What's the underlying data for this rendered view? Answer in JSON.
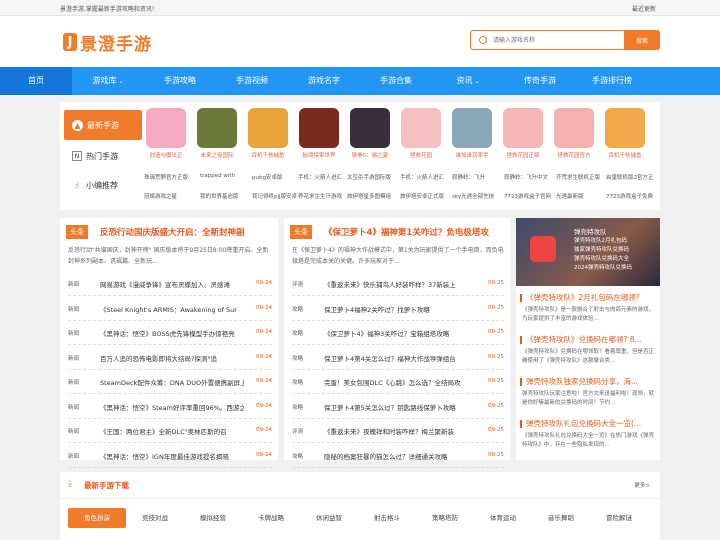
{
  "topbar": {
    "left": "景澄手游,掌握最新手游攻略和资讯!",
    "right": "最近更新"
  },
  "logo": {
    "mark": "J",
    "text": "景澄手游"
  },
  "search": {
    "placeholder": "请输入游戏名称",
    "button": "搜索"
  },
  "nav": [
    "首页",
    "游戏库",
    "手游攻略",
    "手游视频",
    "游戏名字",
    "手游合集",
    "资讯",
    "传奇手游",
    "手游排行榜"
  ],
  "side": [
    "最新手游",
    "热门手游",
    "小编推荐"
  ],
  "games": [
    {
      "name": "创造与魔法正",
      "color": "#f6a9c0"
    },
    {
      "name": "未来之役国际",
      "color": "#6b7a3a"
    },
    {
      "name": "百机千核捕鱼",
      "color": "#e8a43b"
    },
    {
      "name": "秘境探索世界",
      "color": "#7a2a1e"
    },
    {
      "name": "铁拳5：格之夏",
      "color": "#3b2e3a"
    },
    {
      "name": "拯救花园",
      "color": "#f7c0c0"
    },
    {
      "name": "谁加谁润率手",
      "color": "#8aa7b7"
    },
    {
      "name": "拯救花园正版",
      "color": "#f6b6b6"
    },
    {
      "name": "拯救花园官方",
      "color": "#f5b0b0"
    },
    {
      "name": "百机千核捕鱼",
      "color": "#f2a84a"
    }
  ],
  "row1": [
    "珠璃荒野官方正版",
    "trapped with",
    "pubg安卓版",
    "手机：火箭人进汇",
    "太空杀手游国际版",
    "手机：火箭人进汇",
    "寂静岭：飞升",
    "寂静岭：飞升中文",
    "齐荒求生联机正版",
    "启皇联机版2官方正"
  ],
  "row2": [
    "冠姬游戏之星",
    "我的世界基岩版",
    "我记得终pjj版安卓",
    "养花求生生汗游戏",
    "旅伊塔星多图模组",
    "旅伊塔安卓正式版",
    "sky光遇全部先技",
    "7723游戏盒子官网",
    "光遇最新版",
    "7723游戏盒子免费"
  ],
  "col1": {
    "badge": "头条",
    "title": "反恐行动国庆版盛大开启：全新封神副",
    "desc": "反恐行动\"共谱国庆，封神开榜\" 国庆版本将于9月25日8:00降重开启。全新封神系列副本、诱福篇、全新玩...",
    "items": [
      {
        "tag": "新闻",
        "title": "网易游戏《漫威争锋》宣布灵蝶加入、灵感滩",
        "date": "09-24"
      },
      {
        "tag": "新闻",
        "title": "《Steel Knight's ARMIS：Awakening of Sur",
        "date": "09-24"
      },
      {
        "tag": "新闻",
        "title": "《黑神话：悟空》BOSS虎先锋模型手办惊艳亮",
        "date": "09-24"
      },
      {
        "tag": "新闻",
        "title": "百万人追的恐怖电影即将大结局?探测\"追",
        "date": "09-24"
      },
      {
        "tag": "新闻",
        "title": "SteamDeck配件众筹：DNA DUO外置便携副屏上",
        "date": "09-24"
      },
      {
        "tag": "新闻",
        "title": "《黑神话：悟空》Steam好评率重回96%。西游之",
        "date": "09-24"
      },
      {
        "tag": "新闻",
        "title": "《王国：两位君主》全新DLC\"奥林匹斯的召",
        "date": "09-24"
      },
      {
        "tag": "新闻",
        "title": "《黑神话：悟空》IGN年度最佳游戏提名揭晓",
        "date": "09-24"
      }
    ]
  },
  "col2": {
    "badge": "头条",
    "title": "《保卫萝卜4》福神第1关咋过？负电极塔攻",
    "desc": "在《保卫萝卜4》的福神大作战模式中，第1关为玩家提供了一个手电筒，而负电极塔是完成本关的关键。许多玩家对于...",
    "items": [
      {
        "tag": "评测",
        "title": "《重返未来》快乐捕鸟人好装咋样？37新装上",
        "date": "09-25"
      },
      {
        "tag": "攻略",
        "title": "保卫萝卜4福神2关咋过？找萝卜攻略",
        "date": "09-25"
      },
      {
        "tag": "攻略",
        "title": "《保卫萝卜4》福神3关咋过？宝箱组塔攻略",
        "date": "09-25"
      },
      {
        "tag": "攻略",
        "title": "保卫萝卜4第4关怎么过？福神大作战导弹组台",
        "date": "09-25"
      },
      {
        "tag": "攻略",
        "title": "完蛋！美女包围DLC《心跳》怎么选？全结局攻",
        "date": "09-25"
      },
      {
        "tag": "攻略",
        "title": "保卫萝卜4第5关怎么过？钥匙路线保萝卜攻略",
        "date": "09-25"
      },
      {
        "tag": "评测",
        "title": "《重返未来》夜魄祥和时装咋样？梅兰聚新装",
        "date": "09-25"
      },
      {
        "tag": "攻略",
        "title": "隐秘的档案狂暴的猫怎么过？详细通关攻略",
        "date": "09-25"
      }
    ]
  },
  "right": {
    "banner_title": "弹壳特攻队",
    "banner_lines": [
      "弹壳特攻队2月礼包码",
      "独家弹壳特攻队兑换码",
      "弹壳特攻队兑换码大全",
      "2024弹壳特攻队兑换码"
    ],
    "items": [
      {
        "title": "《弹壳特攻队》2月礼包码在哪领?",
        "desc": "《弹壳特攻队》是一款融合了射击与肉鸽元素的游戏，为玩家提供了丰富的游戏体验..."
      },
      {
        "title": "《弹壳特攻队》兑换码在哪领? 8...",
        "desc": "《弹壳特攻队》兑换码在哪领取？看着尊重，但是否正确使用了《弹壳特攻队》这款聚合类..."
      },
      {
        "title": "弹壳特攻队独家兑换码分享，海...",
        "desc": "弹壳特攻队玩家注意啦！官方文来送福利啦！现领，就是你好嘛最新的兑换码的时间！节约..."
      },
      {
        "title": "弹壳特攻队礼包兑换码大全一览(...",
        "desc": "《弹壳特攻队礼包兑换码大全一览》在热门游戏《弹壳特攻队》中，存在一些隐私发现的..."
      }
    ]
  },
  "download": {
    "title": "最新手游下载",
    "more": "更多>",
    "tabs": [
      "角色扮演",
      "竞技对战",
      "模拟经营",
      "卡牌战略",
      "休闲益智",
      "射击格斗",
      "策略塔防",
      "体育运动",
      "音乐舞蹈",
      "冒险解谜"
    ]
  }
}
